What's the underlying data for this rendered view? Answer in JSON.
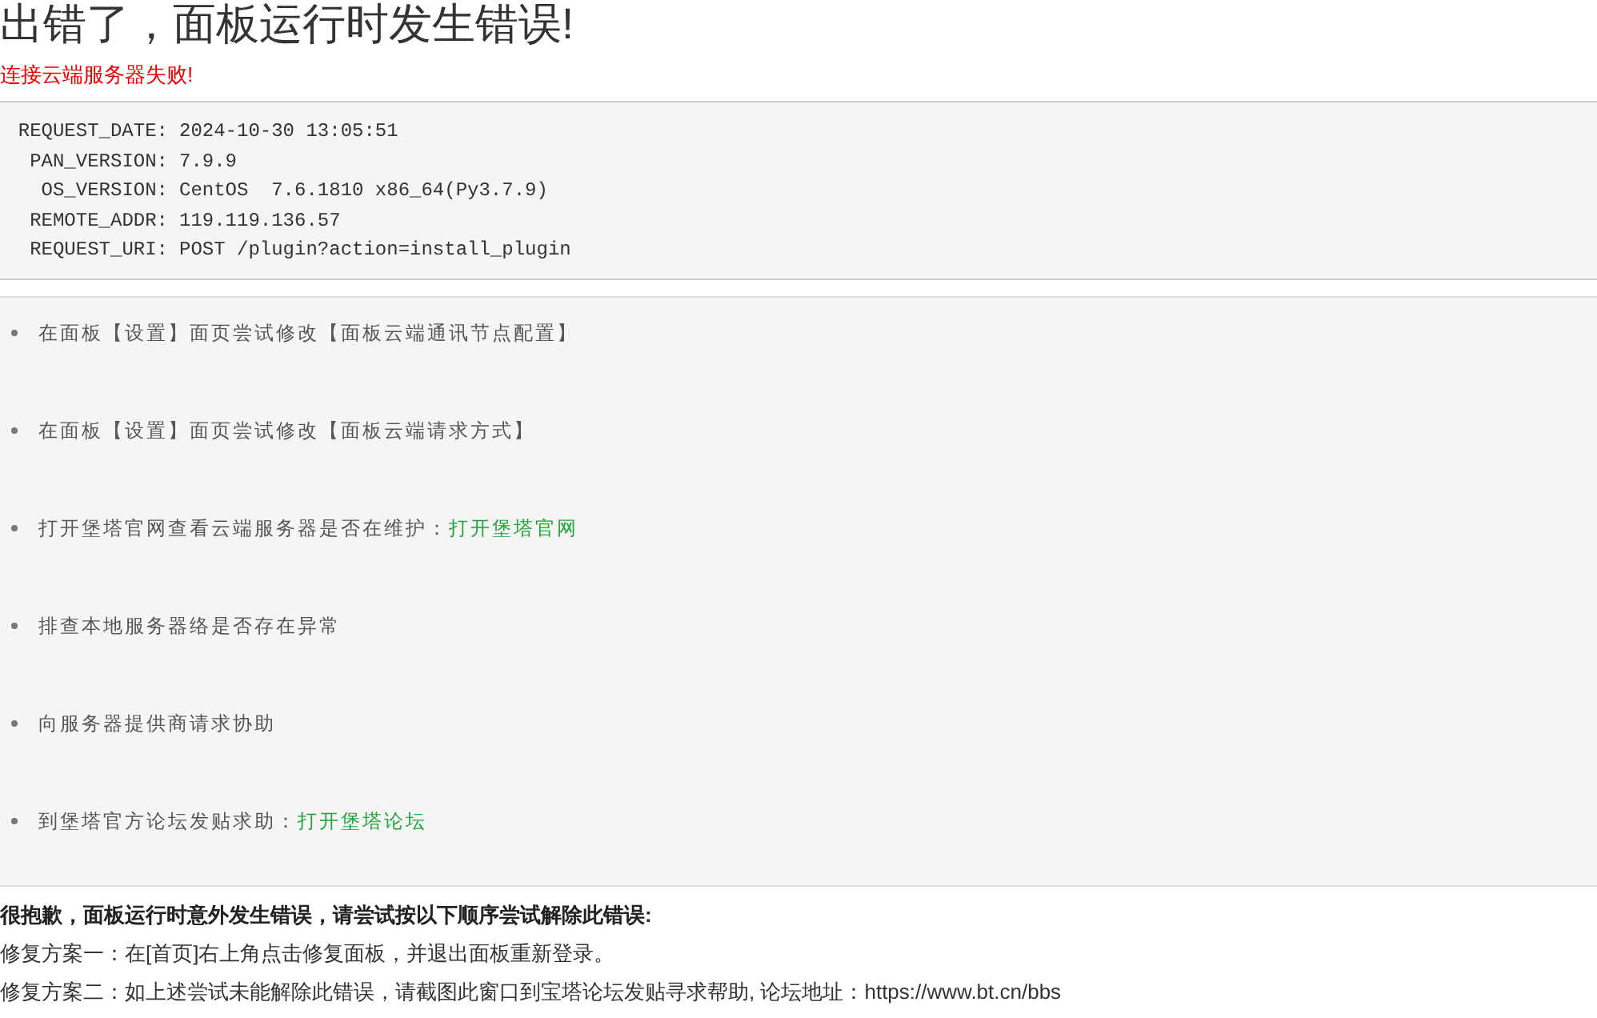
{
  "title": "出错了，面板运行时发生错误!",
  "error_message": "连接云端服务器失败!",
  "request_info": [
    {
      "key": "REQUEST_DATE:",
      "value": "2024-10-30 13:05:51"
    },
    {
      "key": "PAN_VERSION:",
      "value": "7.9.9"
    },
    {
      "key": "OS_VERSION:",
      "value": "CentOS  7.6.1810 x86_64(Py3.7.9)"
    },
    {
      "key": "REMOTE_ADDR:",
      "value": "119.119.136.57"
    },
    {
      "key": "REQUEST_URI:",
      "value": "POST /plugin?action=install_plugin"
    }
  ],
  "suggestions": [
    {
      "text": "在面板【设置】面页尝试修改【面板云端通讯节点配置】"
    },
    {
      "text": "在面板【设置】面页尝试修改【面板云端请求方式】"
    },
    {
      "text": "打开堡塔官网查看云端服务器是否在维护：",
      "link": "打开堡塔官网"
    },
    {
      "text": "排查本地服务器络是否存在异常"
    },
    {
      "text": "向服务器提供商请求协助"
    },
    {
      "text": "到堡塔官方论坛发贴求助：",
      "link": "打开堡塔论坛"
    }
  ],
  "apology": "很抱歉，面板运行时意外发生错误，请尝试按以下顺序尝试解除此错误:",
  "fixes": [
    "修复方案一：在[首页]右上角点击修复面板，并退出面板重新登录。",
    "修复方案二：如上述尝试未能解除此错误，请截图此窗口到宝塔论坛发贴寻求帮助, 论坛地址：https://www.bt.cn/bbs"
  ]
}
